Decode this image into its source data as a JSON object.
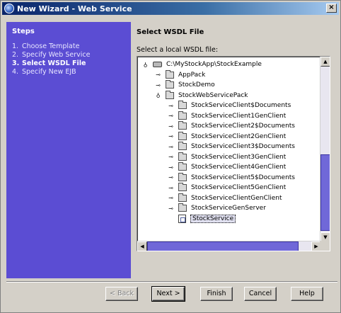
{
  "window": {
    "title": "New Wizard - Web Service",
    "close_glyph": "×"
  },
  "steps": {
    "heading": "Steps",
    "items": [
      {
        "num": "1.",
        "label": "Choose Template"
      },
      {
        "num": "2.",
        "label": "Specify Web Service"
      },
      {
        "num": "3.",
        "label": "Select WSDL File"
      },
      {
        "num": "4.",
        "label": "Specify New EJB"
      }
    ],
    "current_index": 2
  },
  "content": {
    "title": "Select WSDL File",
    "field_label": "Select a local WSDL file:",
    "tree": [
      {
        "label": "C:\\MyStockApp\\StockExample",
        "icon": "drive-icon",
        "handle": "expanded",
        "level": 0
      },
      {
        "label": "AppPack",
        "icon": "folder-icon",
        "handle": "collapsed",
        "level": 1
      },
      {
        "label": "StockDemo",
        "icon": "folder-icon",
        "handle": "collapsed",
        "level": 1
      },
      {
        "label": "StockWebServicePack",
        "icon": "folder-icon",
        "handle": "expanded",
        "level": 1
      },
      {
        "label": "StockServiceClient$Documents",
        "icon": "folder-icon",
        "handle": "collapsed",
        "level": 2
      },
      {
        "label": "StockServiceClient1GenClient",
        "icon": "folder-icon",
        "handle": "collapsed",
        "level": 2
      },
      {
        "label": "StockServiceClient2$Documents",
        "icon": "folder-icon",
        "handle": "collapsed",
        "level": 2
      },
      {
        "label": "StockServiceClient2GenClient",
        "icon": "folder-icon",
        "handle": "collapsed",
        "level": 2
      },
      {
        "label": "StockServiceClient3$Documents",
        "icon": "folder-icon",
        "handle": "collapsed",
        "level": 2
      },
      {
        "label": "StockServiceClient3GenClient",
        "icon": "folder-icon",
        "handle": "collapsed",
        "level": 2
      },
      {
        "label": "StockServiceClient4GenClient",
        "icon": "folder-icon",
        "handle": "collapsed",
        "level": 2
      },
      {
        "label": "StockServiceClient5$Documents",
        "icon": "folder-icon",
        "handle": "collapsed",
        "level": 2
      },
      {
        "label": "StockServiceClient5GenClient",
        "icon": "folder-icon",
        "handle": "collapsed",
        "level": 2
      },
      {
        "label": "StockServiceClientGenClient",
        "icon": "folder-icon",
        "handle": "collapsed",
        "level": 2
      },
      {
        "label": "StockServiceGenServer",
        "icon": "folder-icon",
        "handle": "collapsed",
        "level": 2
      },
      {
        "label": "StockService",
        "icon": "wsdl-file-icon",
        "handle": "none",
        "level": 2,
        "selected": true
      }
    ]
  },
  "buttons": {
    "back": "< Back",
    "next": "Next >",
    "finish": "Finish",
    "cancel": "Cancel",
    "help": "Help"
  },
  "colors": {
    "steps_panel": "#5b4dd3",
    "scroll_thumb": "#7068d8"
  }
}
